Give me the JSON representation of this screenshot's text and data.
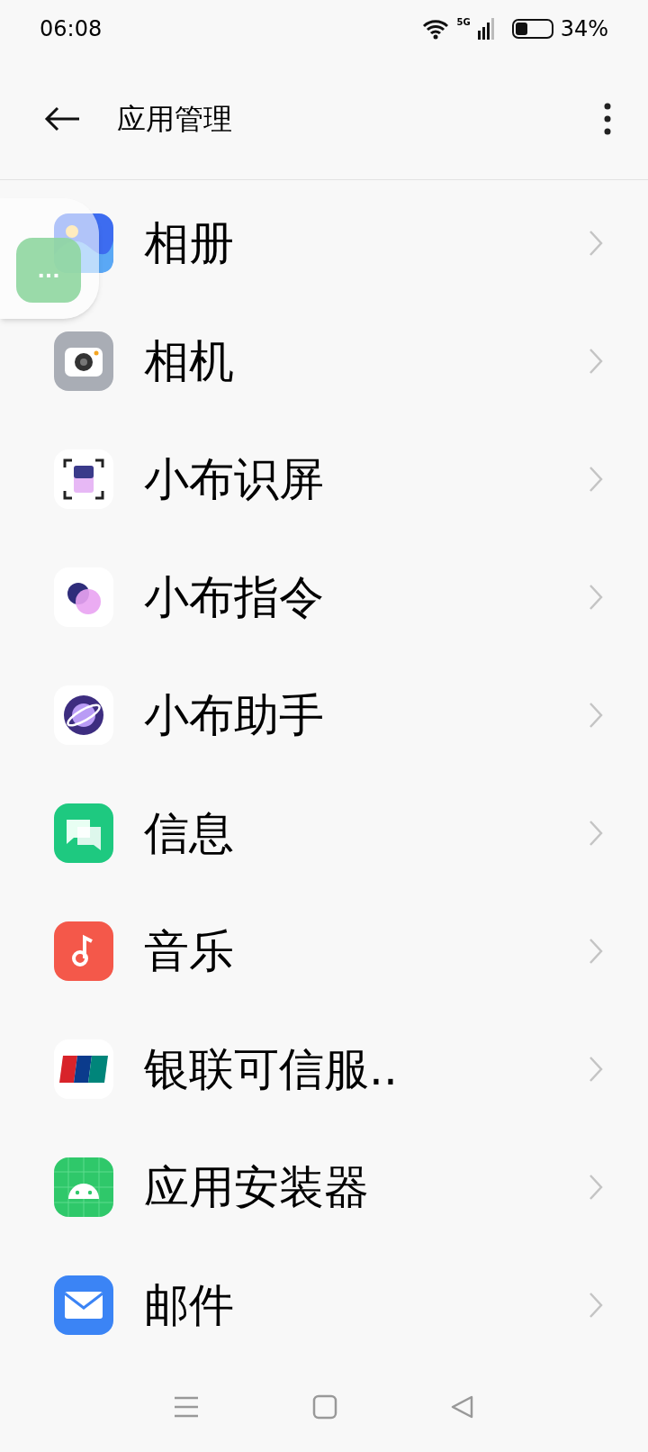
{
  "status_bar": {
    "time": "06:08",
    "network": "5G",
    "battery": "34%"
  },
  "header": {
    "title": "应用管理"
  },
  "apps": [
    {
      "name": "相册",
      "kind": "gallery"
    },
    {
      "name": "相机",
      "kind": "camera"
    },
    {
      "name": "小布识屏",
      "kind": "scan"
    },
    {
      "name": "小布指令",
      "kind": "command"
    },
    {
      "name": "小布助手",
      "kind": "assistant"
    },
    {
      "name": "信息",
      "kind": "messages"
    },
    {
      "name": "音乐",
      "kind": "music"
    },
    {
      "name": "银联可信服..",
      "kind": "unionpay"
    },
    {
      "name": "应用安装器",
      "kind": "installer"
    },
    {
      "name": "邮件",
      "kind": "mail"
    }
  ],
  "floating_bubble": {
    "label": "..."
  }
}
